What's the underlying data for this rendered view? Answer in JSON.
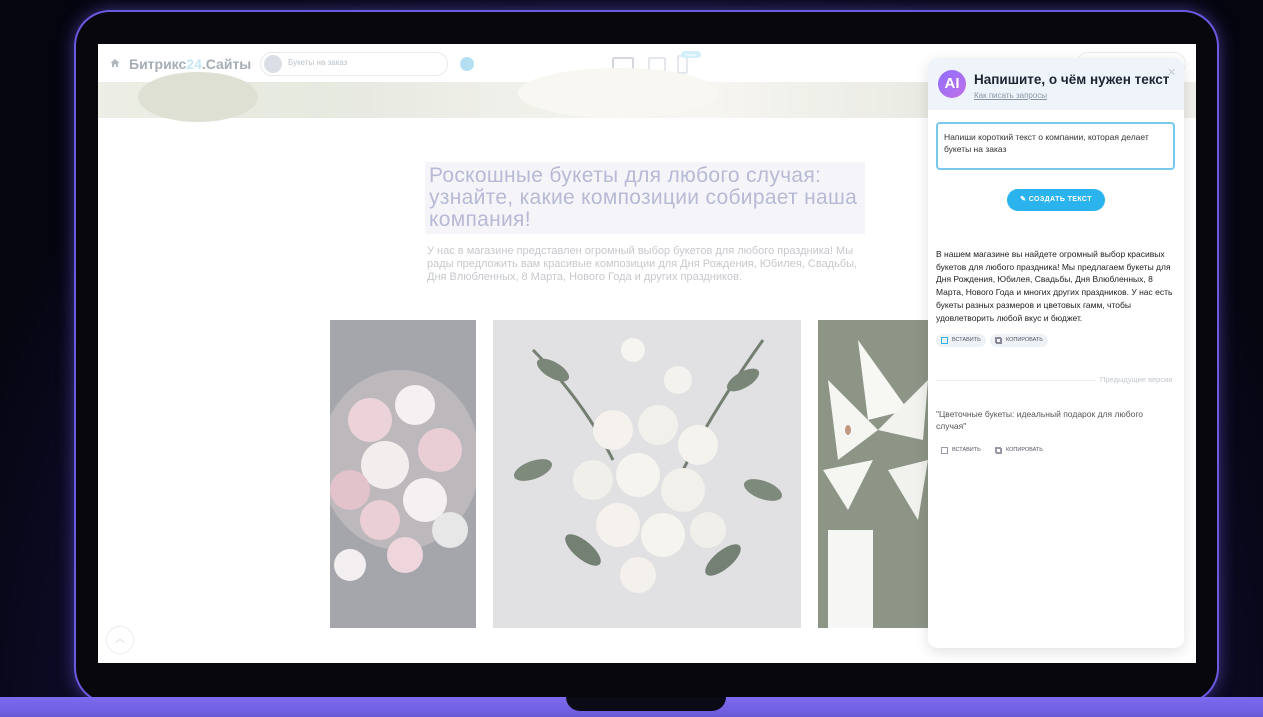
{
  "topbar": {
    "brand_prefix": "Битрикс",
    "brand_num": "24",
    "brand_suffix": ".Сайты",
    "site_name": "Букеты на заказ",
    "new_badge": "новое"
  },
  "page": {
    "headline": "Роскошные букеты для любого случая: узнайте, какие композиции собирает наша компания!",
    "intro": "У нас в магазине представлен огромный выбор букетов для любого праздника! Мы рады предложить вам красивые композиции для Дня Рождения, Юбилея, Свадьбы, Дня Влюбленных, 8 Марта, Нового Года и других праздников."
  },
  "ai_panel": {
    "title": "Напишите, о чём нужен текст",
    "help_link": "Как писать запросы",
    "prompt_value": "Напиши короткий текст о компании, которая делает букеты на заказ",
    "create_button": "СОЗДАТЬ ТЕКСТ",
    "result_text": "В нашем магазине вы найдете огромный выбор красивых букетов для любого праздника! Мы предлагаем букеты для Дня Рождения, Юбилея, Свадьбы, Дня Влюбленных, 8 Марта, Нового Года и многих других праздников. У нас есть букеты разных размеров и цветовых гамм, чтобы удовлетворить любой вкус и бюджет.",
    "insert_label": "ВСТАВИТЬ",
    "copy_label": "КОПИРОВАТЬ",
    "previous_versions_label": "Предыдущие версии",
    "previous_text": "\"Цветочные букеты: идеальный подарок для любого случая\"",
    "prev_insert_label": "ВСТАВИТЬ",
    "prev_copy_label": "КОПИРОВАТЬ"
  },
  "colors": {
    "accent": "#2ab3ec",
    "frame_glow": "#6a5ae0",
    "headline": "#a3a6ca"
  }
}
